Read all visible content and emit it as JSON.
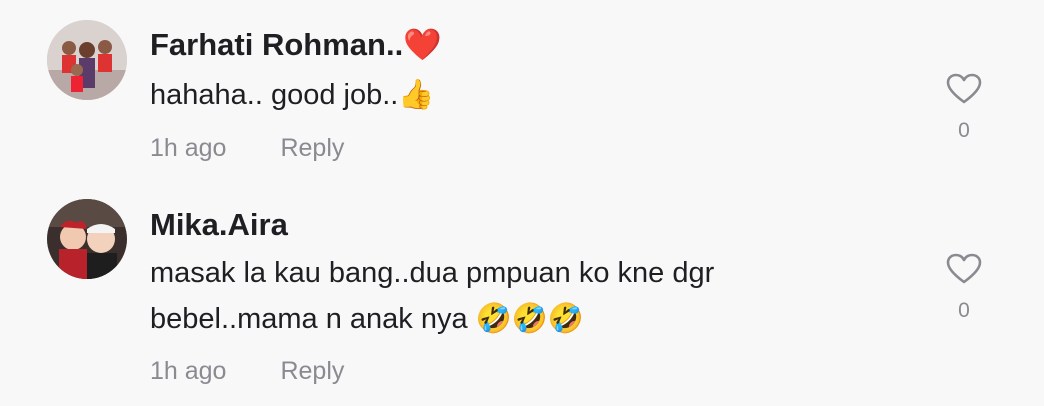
{
  "comments": [
    {
      "username": "Farhati Rohman..❤️",
      "text_lines": [
        "hahaha.. good job..👍"
      ],
      "timestamp": "1h ago",
      "reply_label": "Reply",
      "like_count": "0"
    },
    {
      "username": "Mika.Aira",
      "text_lines": [
        "masak la kau bang..dua pmpuan ko kne dgr",
        "bebel..mama n anak nya 🤣🤣🤣"
      ],
      "timestamp": "1h ago",
      "reply_label": "Reply",
      "like_count": "0"
    }
  ],
  "icons": {
    "like": "heart-outline-icon"
  },
  "colors": {
    "background": "#f8f8f8",
    "text": "#1f1f23",
    "muted": "#8a8b91",
    "heart_emoji": "#e0242a"
  }
}
